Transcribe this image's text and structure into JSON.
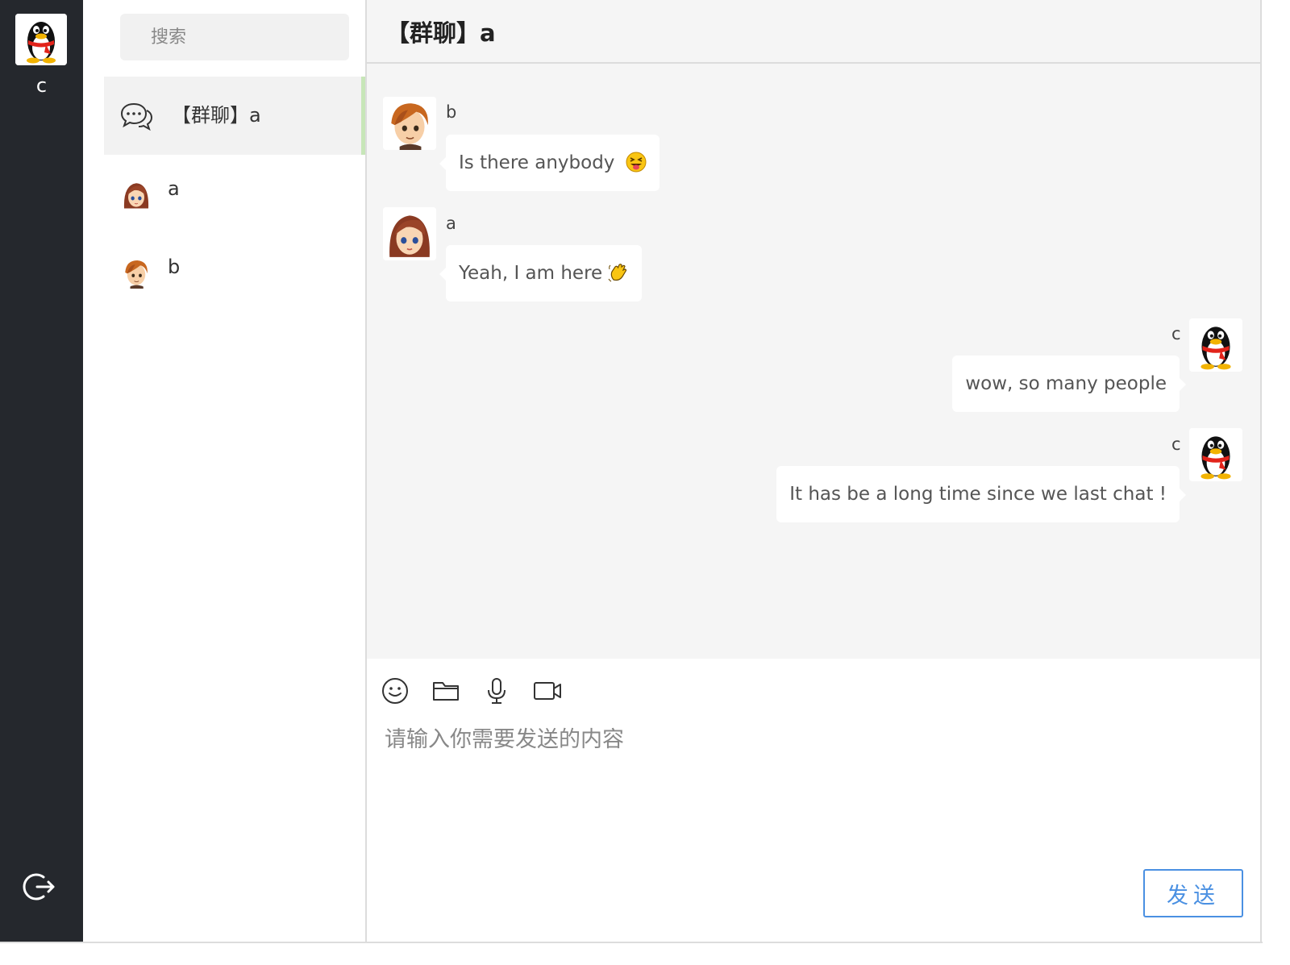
{
  "current_user": {
    "name": "c",
    "avatar": "penguin-avatar"
  },
  "sidebar": {
    "logout_icon": "logout-icon"
  },
  "search": {
    "placeholder": "搜索"
  },
  "contacts": [
    {
      "name": "【群聊】a",
      "icon": "chat-bubbles-icon",
      "active": true
    },
    {
      "name": "a",
      "icon": "girl-avatar",
      "active": false
    },
    {
      "name": "b",
      "icon": "boy-avatar",
      "active": false
    }
  ],
  "chat": {
    "title": "【群聊】a",
    "messages": [
      {
        "sender": "b",
        "text": "Is there anybody",
        "emoji": "squinting-tongue-emoji",
        "side": "left",
        "avatar": "boy-avatar"
      },
      {
        "sender": "a",
        "text": "Yeah, I am here",
        "emoji": "waving-hand-emoji",
        "side": "left",
        "avatar": "girl-avatar"
      },
      {
        "sender": "c",
        "text": "wow, so many people",
        "side": "right",
        "avatar": "penguin-avatar"
      },
      {
        "sender": "c",
        "text": "It has be a long time since we last chat !",
        "side": "right",
        "avatar": "penguin-avatar"
      }
    ]
  },
  "composer": {
    "tools": [
      "smiley-icon",
      "folder-icon",
      "microphone-icon",
      "video-camera-icon"
    ],
    "placeholder": "请输入你需要发送的内容",
    "send_label": "发送"
  },
  "colors": {
    "rail": "#25282d",
    "chat_bg": "#f5f5f5",
    "active_marker": "#c7e6b8",
    "send_accent": "#4a90e2"
  }
}
